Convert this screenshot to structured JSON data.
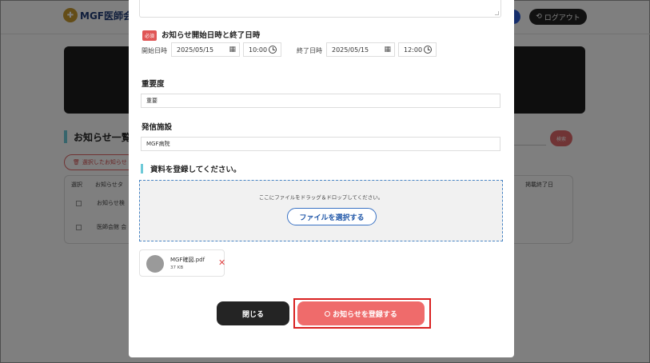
{
  "background": {
    "logo_text": "MGF医師会ポ",
    "logo_subtitle": "",
    "logout_label": "ログアウト",
    "section_title": "お知らせ一覧",
    "search_button": "検索",
    "delete_button": "選択したお知らせ",
    "table_headers": {
      "select": "選択",
      "title": "お知らせタ",
      "end_date": "掲載終了日"
    },
    "rows": [
      {
        "title": "お知らせ検"
      },
      {
        "title": "医師会館 会"
      }
    ]
  },
  "modal": {
    "required_badge": "必須",
    "schedule_label": "お知らせ開始日時と終了日時",
    "start_label": "開始日時",
    "start_date": "2025/05/15",
    "start_time": "10:00",
    "end_label": "終了日時",
    "end_date": "2025/05/15",
    "end_time": "12:00",
    "importance_label": "重要度",
    "importance_value": "重要",
    "facility_label": "発信施設",
    "facility_value": "MGF病院",
    "upload_label": "資料を登録してください。",
    "drop_text": "ここにファイルをドラッグ＆ドロップしてください。",
    "select_file_button": "ファイルを選択する",
    "file": {
      "name": "MGF確図.pdf",
      "size": "37 KB"
    },
    "close_button": "閉じる",
    "register_button": "お知らせを登録する"
  },
  "colors": {
    "primary_dark": "#242424",
    "register_red": "#ef6b6b",
    "highlight_red": "#d92121",
    "accent_cyan": "#6ecad8",
    "link_blue": "#1f56a8"
  }
}
